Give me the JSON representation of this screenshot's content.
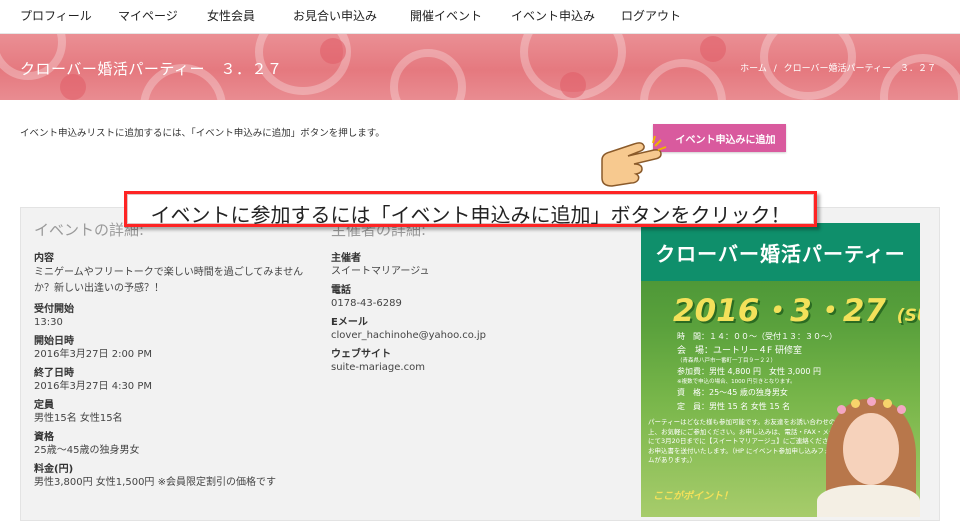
{
  "nav": {
    "items": [
      "プロフィール",
      "マイページ",
      "女性会員",
      "お見合い申込み",
      "開催イベント",
      "イベント申込み",
      "ログアウト"
    ]
  },
  "banner": {
    "title": "クローバー婚活パーティー　３．２７",
    "breadcrumb": {
      "home": "ホーム",
      "separator": "/",
      "current": "クローバー婚活パーティー　３．２７"
    }
  },
  "intro": {
    "text": "イベント申込みリストに追加するには、「イベント申込みに追加」ボタンを押します。",
    "add_button": "イベント申込みに追加"
  },
  "annotation": {
    "text": "イベントに参加するには「イベント申込みに追加」ボタンをクリック！"
  },
  "details": {
    "heading": "イベントの詳細:",
    "fields": [
      {
        "label": "内容",
        "value": "ミニゲームやフリートークで楽しい時間を過ごしてみませんか？新しい出逢いの予感？！"
      },
      {
        "label": "受付開始",
        "value": "13:30"
      },
      {
        "label": "開始日時",
        "value": "2016年3月27日 2:00 PM"
      },
      {
        "label": "終了日時",
        "value": "2016年3月27日 4:30 PM"
      },
      {
        "label": "定員",
        "value": "男性15名  女性15名"
      },
      {
        "label": "資格",
        "value": "25歳〜45歳の独身男女"
      },
      {
        "label": "料金(円)",
        "value": "男性3,800円  女性1,500円  ※会員限定割引の価格です"
      }
    ]
  },
  "organizer": {
    "heading": "主催者の詳細:",
    "fields": [
      {
        "label": "主催者",
        "value": "スイートマリアージュ"
      },
      {
        "label": "電話",
        "value": "0178-43-6289"
      },
      {
        "label": "Eメール",
        "value": "clover_hachinohe@yahoo.co.jp"
      },
      {
        "label": "ウェブサイト",
        "value": "suite-mariage.com"
      }
    ]
  },
  "poster": {
    "title": "クローバー婚活パーティー",
    "date": "2016・3・27",
    "weekday": "(SUN)",
    "time": "時　間：１４：００〜（受付１３：３０〜）",
    "venue": "会　場：ユートリー４F 研修室",
    "venue_sub": "（青森県八戸市一番町一丁目９ー２２）",
    "fee": "参加費：男性 4,800 円　女性 3,000 円",
    "fee_sub": "※複数で申込の場合、1000 円引きとなります。",
    "eligibility": "資　格：25〜45 歳の独身男女",
    "capacity": "定　員：男性 15 名  女性 15 名",
    "note": "パーティーはどなた様も参加可能です。お友達をお誘い合わせの上、お気軽にご参加ください。お申し込みは、電話・FAX・メールにて3月20日までに【スイートマリアージュ】にご連絡ください。お申込書を送付いたします。（HP にイベント参加申し込みフォームがあります。）",
    "point": "ここがポイント！"
  }
}
